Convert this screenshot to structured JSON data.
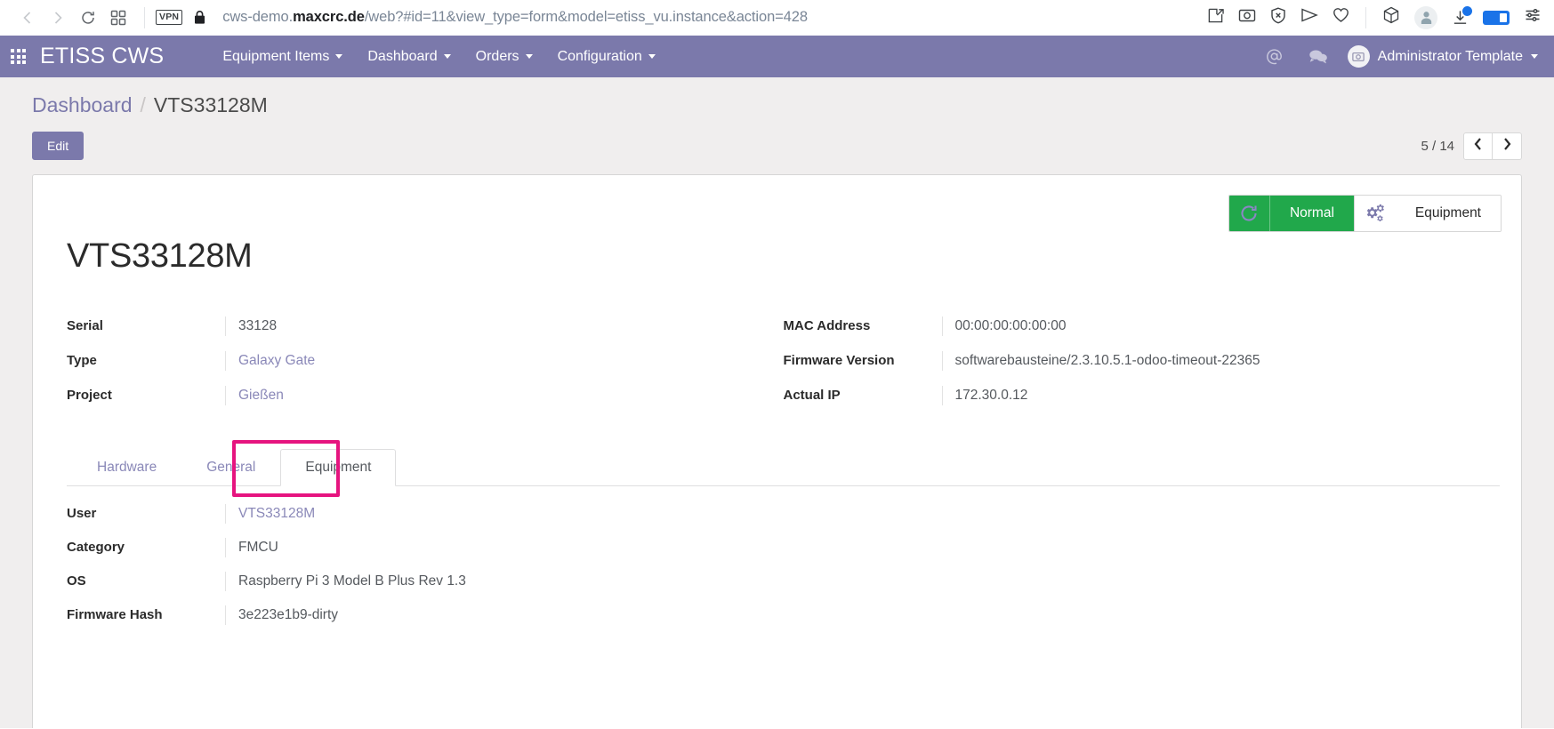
{
  "browser": {
    "back_icon": "back-arrow-icon",
    "forward_icon": "forward-arrow-icon",
    "reload_icon": "reload-icon",
    "tabs_icon": "tab-grid-icon",
    "vpn_label": "VPN",
    "lock_icon": "lock-icon",
    "url_prefix": "cws-demo.",
    "url_domain": "maxcrc.de",
    "url_suffix": "/web?#id=11&view_type=form&model=etiss_vu.instance&action=428",
    "url_full": "cws-demo.maxcrc.de/web?#id=11&view_type=form&model=etiss_vu.instance&action=428",
    "right_icons": [
      "pin-note-icon",
      "camera-icon",
      "shield-block-icon",
      "send-icon",
      "heart-icon",
      "cube-icon",
      "profile-avatar-icon",
      "download-icon",
      "battery-icon",
      "settings-sliders-icon"
    ]
  },
  "navbar": {
    "apps_icon": "apps-grid-icon",
    "brand": "ETISS CWS",
    "menu": [
      {
        "label": "Equipment Items",
        "has_caret": true
      },
      {
        "label": "Dashboard",
        "has_caret": true
      },
      {
        "label": "Orders",
        "has_caret": true
      },
      {
        "label": "Configuration",
        "has_caret": true
      }
    ],
    "mention_icon": "at-mention-icon",
    "chat_icon": "chat-bubble-icon",
    "user_avatar_icon": "user-avatar-camera-icon",
    "user_name": "Administrator Template"
  },
  "control_panel": {
    "breadcrumb": {
      "parent": "Dashboard",
      "separator": "/",
      "current": "VTS33128M"
    },
    "edit_label": "Edit",
    "pager_count": "5 / 14",
    "prev_icon": "chevron-left-icon",
    "next_icon": "chevron-right-icon"
  },
  "sheet": {
    "stat_buttons": [
      {
        "icon": "refresh-circular-arrow-icon",
        "label": "Normal",
        "color": "#21a84b",
        "style": "green"
      },
      {
        "icon": "gears-icon",
        "label": "Equipment",
        "color": "#ffffff",
        "style": "plain"
      }
    ],
    "record_title": "VTS33128M",
    "fields_left": [
      {
        "label": "Serial",
        "value": "33128",
        "is_link": false
      },
      {
        "label": "Type",
        "value": "Galaxy Gate",
        "is_link": true
      },
      {
        "label": "Project",
        "value": "Gießen",
        "is_link": true
      }
    ],
    "fields_right": [
      {
        "label": "MAC Address",
        "value": "00:00:00:00:00:00",
        "is_link": false
      },
      {
        "label": "Firmware Version",
        "value": "softwarebausteine/2.3.10.5.1-odoo-timeout-22365",
        "is_link": false
      },
      {
        "label": "Actual IP",
        "value": "172.30.0.12",
        "is_link": false
      }
    ],
    "tabs": [
      {
        "label": "Hardware",
        "active": false
      },
      {
        "label": "General",
        "active": false
      },
      {
        "label": "Equipment",
        "active": true,
        "highlighted": true
      }
    ],
    "tab_fields": [
      {
        "label": "User",
        "value": "VTS33128M",
        "is_link": true
      },
      {
        "label": "Category",
        "value": "FMCU",
        "is_link": false
      },
      {
        "label": "OS",
        "value": "Raspberry Pi 3 Model B Plus Rev 1.3",
        "is_link": false
      },
      {
        "label": "Firmware Hash",
        "value": "3e223e1b9-dirty",
        "is_link": false
      }
    ]
  },
  "colors": {
    "brand_purple": "#7b79ab",
    "status_green": "#21a84b",
    "highlight_pink": "#e6147f",
    "link_purple": "#8a88b8"
  }
}
